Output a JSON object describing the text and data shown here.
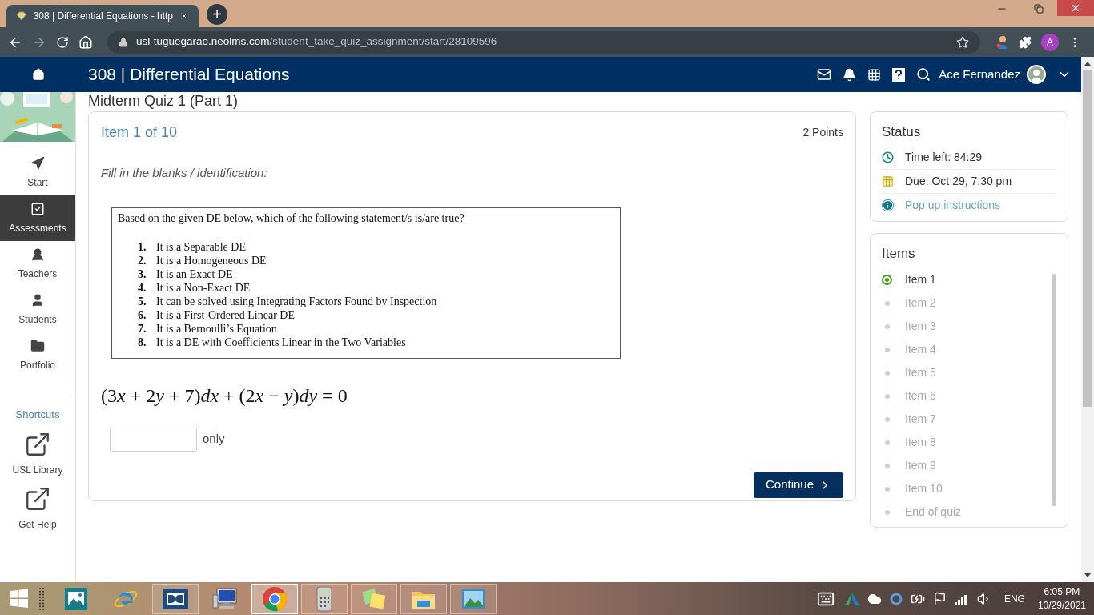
{
  "browser": {
    "tab_title": "308 | Differential Equations - http",
    "new_tab": "+",
    "url_domain": "usl-tuguegarao.neolms.com",
    "url_path": "/student_take_quiz_assignment/start/28109596",
    "profile_initial": "A"
  },
  "header": {
    "course_title": "308 | Differential Equations",
    "user_name": "Ace Fernandez"
  },
  "sidebar": {
    "items": [
      {
        "kind": "start",
        "label": "Start",
        "selected": false
      },
      {
        "kind": "assessments",
        "label": "Assessments",
        "selected": true
      },
      {
        "kind": "teachers",
        "label": "Teachers",
        "selected": false
      },
      {
        "kind": "students",
        "label": "Students",
        "selected": false
      },
      {
        "kind": "portfolio",
        "label": "Portfolio",
        "selected": false
      }
    ],
    "shortcuts_title": "Shortcuts",
    "shortcuts": [
      {
        "label": "USL Library"
      },
      {
        "label": "Get Help"
      }
    ]
  },
  "quiz": {
    "page_title": "Midterm Quiz 1 (Part 1)",
    "item_heading": "Item 1 of 10",
    "points": "2 Points",
    "instruction": "Fill in the blanks / identification:",
    "question_image": {
      "prompt": "Based on the given DE below, which of the following statement/s is/are true?",
      "statements": [
        {
          "number": "1.",
          "text": "It is a Separable DE"
        },
        {
          "number": "2.",
          "text": "It is a Homogeneous DE"
        },
        {
          "number": "3.",
          "text": "It is an Exact DE"
        },
        {
          "number": "4.",
          "text": "It is a Non-Exact DE"
        },
        {
          "number": "5.",
          "text": "It can be solved using Integrating Factors Found by Inspection"
        },
        {
          "number": "6.",
          "text": "It is a First-Ordered Linear DE"
        },
        {
          "number": "7.",
          "text": "It is a Bernoulli’s Equation"
        },
        {
          "number": "8.",
          "text": "It is a DE with Coefficients Linear in the Two Variables"
        }
      ]
    },
    "equation": [
      {
        "text": "(3",
        "italic": false
      },
      {
        "text": "x",
        "italic": true
      },
      {
        "text": " + 2",
        "italic": false
      },
      {
        "text": "y",
        "italic": true
      },
      {
        "text": " + 7)",
        "italic": false
      },
      {
        "text": "dx",
        "italic": true
      },
      {
        "text": " + (2",
        "italic": false
      },
      {
        "text": "x",
        "italic": true
      },
      {
        "text": " − ",
        "italic": false
      },
      {
        "text": "y",
        "italic": true
      },
      {
        "text": ")",
        "italic": false
      },
      {
        "text": "dy",
        "italic": true
      },
      {
        "text": " = 0",
        "italic": false
      }
    ],
    "answer_suffix": "only",
    "continue_button": "Continue"
  },
  "status": {
    "title": "Status",
    "rows": [
      {
        "kind": "time",
        "text": "Time left: 84:29"
      },
      {
        "kind": "due",
        "text": "Due: Oct 29, 7:30 pm"
      },
      {
        "kind": "link",
        "text": "Pop up instructions"
      }
    ]
  },
  "items_panel": {
    "title": "Items",
    "items": [
      {
        "label": "Item 1",
        "selected": true
      },
      {
        "label": "Item 2",
        "selected": false
      },
      {
        "label": "Item 3",
        "selected": false
      },
      {
        "label": "Item 4",
        "selected": false
      },
      {
        "label": "Item 5",
        "selected": false
      },
      {
        "label": "Item 6",
        "selected": false
      },
      {
        "label": "Item 7",
        "selected": false
      },
      {
        "label": "Item 8",
        "selected": false
      },
      {
        "label": "Item 9",
        "selected": false
      },
      {
        "label": "Item 10",
        "selected": false
      },
      {
        "label": "End of quiz",
        "selected": false
      }
    ]
  },
  "taskbar": {
    "apps": [
      {
        "kind": "photos",
        "open": false,
        "active": false
      },
      {
        "kind": "ie",
        "open": false,
        "active": false
      },
      {
        "kind": "dolby",
        "open": true,
        "active": false
      },
      {
        "kind": "computer",
        "open": false,
        "active": false
      },
      {
        "kind": "chrome",
        "open": true,
        "active": true
      },
      {
        "kind": "calculator",
        "open": true,
        "active": false
      },
      {
        "kind": "notes",
        "open": true,
        "active": false
      },
      {
        "kind": "explorer",
        "open": true,
        "active": false
      },
      {
        "kind": "gallery",
        "open": true,
        "active": false
      }
    ],
    "language": "ENG",
    "time": "6:05 PM",
    "date": "10/29/2021"
  }
}
